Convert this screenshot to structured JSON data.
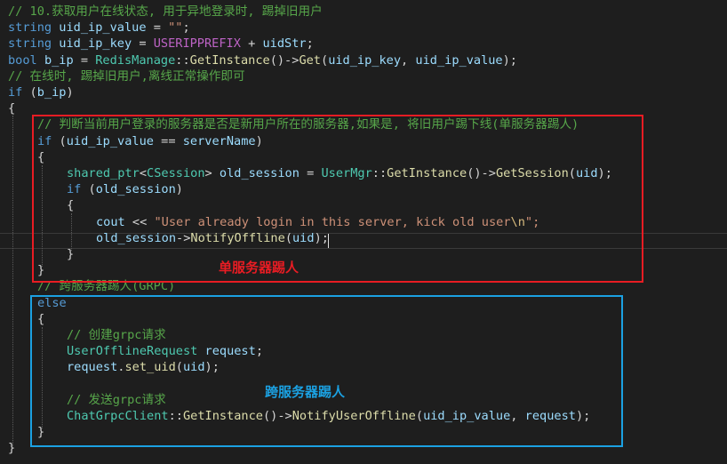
{
  "editor": {
    "lines": [
      {
        "indent": 0,
        "tokens": [
          {
            "t": "// 10.获取用户在线状态, 用于异地登录时, 踢掉旧用户",
            "c": "comment"
          }
        ]
      },
      {
        "indent": 0,
        "tokens": [
          {
            "t": "string",
            "c": "kw"
          },
          {
            "t": " ",
            "c": "punc"
          },
          {
            "t": "uid_ip_value",
            "c": "var"
          },
          {
            "t": " = ",
            "c": "punc"
          },
          {
            "t": "\"\"",
            "c": "str"
          },
          {
            "t": ";",
            "c": "punc"
          }
        ]
      },
      {
        "indent": 0,
        "tokens": [
          {
            "t": "string",
            "c": "kw"
          },
          {
            "t": " ",
            "c": "punc"
          },
          {
            "t": "uid_ip_key",
            "c": "var"
          },
          {
            "t": " = ",
            "c": "punc"
          },
          {
            "t": "USERIPPREFIX",
            "c": "macro"
          },
          {
            "t": " + ",
            "c": "punc"
          },
          {
            "t": "uidStr",
            "c": "var"
          },
          {
            "t": ";",
            "c": "punc"
          }
        ]
      },
      {
        "indent": 0,
        "tokens": [
          {
            "t": "bool",
            "c": "kw"
          },
          {
            "t": " ",
            "c": "punc"
          },
          {
            "t": "b_ip",
            "c": "var"
          },
          {
            "t": " = ",
            "c": "punc"
          },
          {
            "t": "RedisManage",
            "c": "ns"
          },
          {
            "t": "::",
            "c": "punc"
          },
          {
            "t": "GetInstance",
            "c": "fn"
          },
          {
            "t": "()->",
            "c": "punc"
          },
          {
            "t": "Get",
            "c": "fn"
          },
          {
            "t": "(",
            "c": "punc"
          },
          {
            "t": "uid_ip_key",
            "c": "var"
          },
          {
            "t": ", ",
            "c": "punc"
          },
          {
            "t": "uid_ip_value",
            "c": "var"
          },
          {
            "t": ");",
            "c": "punc"
          }
        ]
      },
      {
        "indent": 0,
        "tokens": [
          {
            "t": "// 在线时, 踢掉旧用户,离线正常操作即可",
            "c": "comment"
          }
        ]
      },
      {
        "indent": 0,
        "tokens": [
          {
            "t": "if",
            "c": "kw"
          },
          {
            "t": " (",
            "c": "punc"
          },
          {
            "t": "b_ip",
            "c": "var"
          },
          {
            "t": ")",
            "c": "punc"
          }
        ]
      },
      {
        "indent": 0,
        "tokens": [
          {
            "t": "{",
            "c": "punc"
          }
        ]
      },
      {
        "indent": 1,
        "tokens": [
          {
            "t": "// 判断当前用户登录的服务器是否是新用户所在的服务器,如果是, 将旧用户踢下线(单服务器踢人)",
            "c": "comment"
          }
        ]
      },
      {
        "indent": 1,
        "tokens": [
          {
            "t": "if",
            "c": "kw"
          },
          {
            "t": " (",
            "c": "punc"
          },
          {
            "t": "uid_ip_value",
            "c": "var"
          },
          {
            "t": " == ",
            "c": "punc"
          },
          {
            "t": "serverName",
            "c": "var"
          },
          {
            "t": ")",
            "c": "punc"
          }
        ]
      },
      {
        "indent": 1,
        "tokens": [
          {
            "t": "{",
            "c": "punc"
          }
        ]
      },
      {
        "indent": 2,
        "tokens": [
          {
            "t": "shared_ptr",
            "c": "type"
          },
          {
            "t": "<",
            "c": "punc"
          },
          {
            "t": "CSession",
            "c": "type"
          },
          {
            "t": "> ",
            "c": "punc"
          },
          {
            "t": "old_session",
            "c": "var"
          },
          {
            "t": " = ",
            "c": "punc"
          },
          {
            "t": "UserMgr",
            "c": "ns"
          },
          {
            "t": "::",
            "c": "punc"
          },
          {
            "t": "GetInstance",
            "c": "fn"
          },
          {
            "t": "()->",
            "c": "punc"
          },
          {
            "t": "GetSession",
            "c": "fn"
          },
          {
            "t": "(",
            "c": "punc"
          },
          {
            "t": "uid",
            "c": "var"
          },
          {
            "t": ");",
            "c": "punc"
          }
        ]
      },
      {
        "indent": 2,
        "tokens": [
          {
            "t": "if",
            "c": "kw"
          },
          {
            "t": " (",
            "c": "punc"
          },
          {
            "t": "old_session",
            "c": "var"
          },
          {
            "t": ")",
            "c": "punc"
          }
        ]
      },
      {
        "indent": 2,
        "tokens": [
          {
            "t": "{",
            "c": "punc"
          }
        ]
      },
      {
        "indent": 3,
        "tokens": [
          {
            "t": "cout",
            "c": "var"
          },
          {
            "t": " << ",
            "c": "punc"
          },
          {
            "t": "\"User already login in this server, kick old user",
            "c": "str"
          },
          {
            "t": "\\n",
            "c": "esc"
          },
          {
            "t": "\";",
            "c": "str"
          }
        ]
      },
      {
        "indent": 3,
        "tokens": [
          {
            "t": "old_session",
            "c": "var"
          },
          {
            "t": "->",
            "c": "punc"
          },
          {
            "t": "NotifyOffline",
            "c": "fn"
          },
          {
            "t": "(",
            "c": "punc"
          },
          {
            "t": "uid",
            "c": "var"
          },
          {
            "t": ");",
            "c": "punc"
          }
        ]
      },
      {
        "indent": 2,
        "tokens": [
          {
            "t": "}",
            "c": "punc"
          }
        ]
      },
      {
        "indent": 1,
        "tokens": [
          {
            "t": "}",
            "c": "punc"
          }
        ]
      },
      {
        "indent": 1,
        "tokens": [
          {
            "t": "// 跨服务器踢人(GRPC)",
            "c": "comment"
          }
        ]
      },
      {
        "indent": 1,
        "tokens": [
          {
            "t": "else",
            "c": "kw"
          }
        ]
      },
      {
        "indent": 1,
        "tokens": [
          {
            "t": "{",
            "c": "punc"
          }
        ]
      },
      {
        "indent": 2,
        "tokens": [
          {
            "t": "// 创建grpc请求",
            "c": "comment"
          }
        ]
      },
      {
        "indent": 2,
        "tokens": [
          {
            "t": "UserOfflineRequest",
            "c": "type"
          },
          {
            "t": " ",
            "c": "punc"
          },
          {
            "t": "request",
            "c": "var"
          },
          {
            "t": ";",
            "c": "punc"
          }
        ]
      },
      {
        "indent": 2,
        "tokens": [
          {
            "t": "request",
            "c": "var"
          },
          {
            "t": ".",
            "c": "punc"
          },
          {
            "t": "set_uid",
            "c": "fn"
          },
          {
            "t": "(",
            "c": "punc"
          },
          {
            "t": "uid",
            "c": "var"
          },
          {
            "t": ");",
            "c": "punc"
          }
        ]
      },
      {
        "indent": 2,
        "tokens": []
      },
      {
        "indent": 2,
        "tokens": [
          {
            "t": "// 发送grpc请求",
            "c": "comment"
          }
        ]
      },
      {
        "indent": 2,
        "tokens": [
          {
            "t": "ChatGrpcClient",
            "c": "ns"
          },
          {
            "t": "::",
            "c": "punc"
          },
          {
            "t": "GetInstance",
            "c": "fn"
          },
          {
            "t": "()->",
            "c": "punc"
          },
          {
            "t": "NotifyUserOffline",
            "c": "fn"
          },
          {
            "t": "(",
            "c": "punc"
          },
          {
            "t": "uid_ip_value",
            "c": "var"
          },
          {
            "t": ", ",
            "c": "punc"
          },
          {
            "t": "request",
            "c": "var"
          },
          {
            "t": ");",
            "c": "punc"
          }
        ]
      },
      {
        "indent": 1,
        "tokens": [
          {
            "t": "}",
            "c": "punc"
          }
        ]
      },
      {
        "indent": 0,
        "tokens": [
          {
            "t": "}",
            "c": "punc"
          }
        ]
      }
    ]
  },
  "annotations": {
    "single_server": "单服务器踢人",
    "cross_server": "跨服务器踢人"
  },
  "colors": {
    "background": "#1e1e1e",
    "red_box": "#e81c23",
    "blue_box": "#1ba1e2"
  }
}
